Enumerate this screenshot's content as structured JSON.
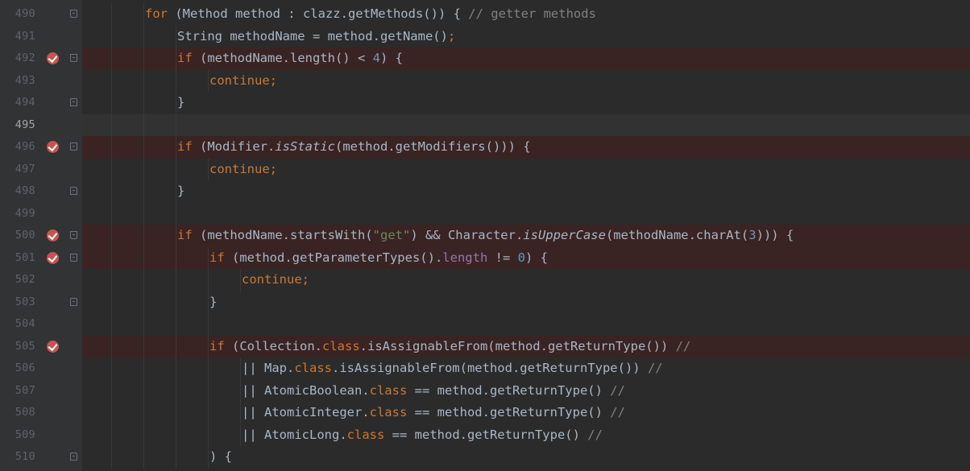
{
  "editor": {
    "colors": {
      "background": "#2b2b2b",
      "gutter": "#313335",
      "breakpoint_line": "#3a2323",
      "breakpoint_icon": "#c75450",
      "keyword": "#cc7832",
      "string": "#6a8759",
      "number": "#6897bb",
      "comment": "#808080",
      "field": "#9876aa",
      "text": "#a9b7c6"
    },
    "lines": [
      {
        "num": "490",
        "indent": 2,
        "bp": false,
        "fold": "open",
        "segments": [
          {
            "t": "kw",
            "v": "for"
          },
          {
            "t": "",
            "v": " (Method method : clazz.getMethods()) { "
          },
          {
            "t": "cmt",
            "v": "// getter methods"
          }
        ]
      },
      {
        "num": "491",
        "indent": 3,
        "bp": false,
        "fold": "",
        "segments": [
          {
            "t": "",
            "v": "String methodName = method.getName()"
          },
          {
            "t": "kw",
            "v": ";"
          }
        ]
      },
      {
        "num": "492",
        "indent": 3,
        "bp": true,
        "fold": "open",
        "segments": [
          {
            "t": "kw",
            "v": "if"
          },
          {
            "t": "",
            "v": " (methodName.length() < "
          },
          {
            "t": "numlit",
            "v": "4"
          },
          {
            "t": "",
            "v": ") {"
          }
        ]
      },
      {
        "num": "493",
        "indent": 4,
        "bp": false,
        "fold": "",
        "segments": [
          {
            "t": "kw",
            "v": "continue;"
          }
        ]
      },
      {
        "num": "494",
        "indent": 3,
        "bp": false,
        "fold": "close",
        "segments": [
          {
            "t": "",
            "v": "}"
          }
        ]
      },
      {
        "num": "495",
        "indent": 3,
        "bp": false,
        "fold": "",
        "caret": true,
        "segments": []
      },
      {
        "num": "496",
        "indent": 3,
        "bp": true,
        "fold": "open",
        "segments": [
          {
            "t": "kw",
            "v": "if"
          },
          {
            "t": "",
            "v": " (Modifier."
          },
          {
            "t": "it",
            "v": "isStatic"
          },
          {
            "t": "",
            "v": "(method.getModifiers())) {"
          }
        ]
      },
      {
        "num": "497",
        "indent": 4,
        "bp": false,
        "fold": "",
        "segments": [
          {
            "t": "kw",
            "v": "continue;"
          }
        ]
      },
      {
        "num": "498",
        "indent": 3,
        "bp": false,
        "fold": "close",
        "segments": [
          {
            "t": "",
            "v": "}"
          }
        ]
      },
      {
        "num": "499",
        "indent": 3,
        "bp": false,
        "fold": "",
        "segments": []
      },
      {
        "num": "500",
        "indent": 3,
        "bp": true,
        "fold": "open",
        "segments": [
          {
            "t": "kw",
            "v": "if"
          },
          {
            "t": "",
            "v": " (methodName.startsWith("
          },
          {
            "t": "str",
            "v": "\"get\""
          },
          {
            "t": "",
            "v": ") && Character."
          },
          {
            "t": "it",
            "v": "isUpperCase"
          },
          {
            "t": "",
            "v": "(methodName.charAt("
          },
          {
            "t": "numlit",
            "v": "3"
          },
          {
            "t": "",
            "v": "))) {"
          }
        ]
      },
      {
        "num": "501",
        "indent": 4,
        "bp": true,
        "fold": "open",
        "segments": [
          {
            "t": "kw",
            "v": "if"
          },
          {
            "t": "",
            "v": " (method.getParameterTypes()."
          },
          {
            "t": "fld",
            "v": "length"
          },
          {
            "t": "",
            "v": " != "
          },
          {
            "t": "numlit",
            "v": "0"
          },
          {
            "t": "",
            "v": ") {"
          }
        ]
      },
      {
        "num": "502",
        "indent": 5,
        "bp": false,
        "fold": "",
        "segments": [
          {
            "t": "kw",
            "v": "continue;"
          }
        ]
      },
      {
        "num": "503",
        "indent": 4,
        "bp": false,
        "fold": "close",
        "segments": [
          {
            "t": "",
            "v": "}"
          }
        ]
      },
      {
        "num": "504",
        "indent": 4,
        "bp": false,
        "fold": "",
        "segments": []
      },
      {
        "num": "505",
        "indent": 4,
        "bp": true,
        "fold": "",
        "segments": [
          {
            "t": "kw",
            "v": "if"
          },
          {
            "t": "",
            "v": " (Collection."
          },
          {
            "t": "kw",
            "v": "class"
          },
          {
            "t": "",
            "v": ".isAssignableFrom(method.getReturnType()) "
          },
          {
            "t": "cmt",
            "v": "//"
          }
        ]
      },
      {
        "num": "506",
        "indent": 5,
        "bp": false,
        "fold": "",
        "segments": [
          {
            "t": "",
            "v": "|| Map."
          },
          {
            "t": "kw",
            "v": "class"
          },
          {
            "t": "",
            "v": ".isAssignableFrom(method.getReturnType()) "
          },
          {
            "t": "cmt",
            "v": "//"
          }
        ]
      },
      {
        "num": "507",
        "indent": 5,
        "bp": false,
        "fold": "",
        "segments": [
          {
            "t": "",
            "v": "|| AtomicBoolean."
          },
          {
            "t": "kw",
            "v": "class"
          },
          {
            "t": "",
            "v": " == method.getReturnType() "
          },
          {
            "t": "cmt",
            "v": "//"
          }
        ]
      },
      {
        "num": "508",
        "indent": 5,
        "bp": false,
        "fold": "",
        "segments": [
          {
            "t": "",
            "v": "|| AtomicInteger."
          },
          {
            "t": "kw",
            "v": "class"
          },
          {
            "t": "",
            "v": " == method.getReturnType() "
          },
          {
            "t": "cmt",
            "v": "//"
          }
        ]
      },
      {
        "num": "509",
        "indent": 5,
        "bp": false,
        "fold": "",
        "segments": [
          {
            "t": "",
            "v": "|| AtomicLong."
          },
          {
            "t": "kw",
            "v": "class"
          },
          {
            "t": "",
            "v": " == method.getReturnType() "
          },
          {
            "t": "cmt",
            "v": "//"
          }
        ]
      },
      {
        "num": "510",
        "indent": 4,
        "bp": false,
        "fold": "close",
        "segments": [
          {
            "t": "",
            "v": ") {"
          }
        ]
      }
    ]
  }
}
